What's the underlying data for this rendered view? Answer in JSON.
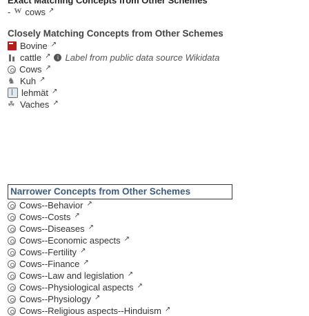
{
  "header": {
    "title": "Exact Matching Concepts from Other Schemes",
    "link_text": "cows"
  },
  "closely_matching": {
    "heading": "Closely Matching Concepts from Other Schemes",
    "items": [
      {
        "label": "Bovine",
        "icon": "flag-icon"
      },
      {
        "label": "cattle",
        "icon": "chart-icon",
        "note": "Label from public data source Wikidata"
      },
      {
        "label": "Cows",
        "icon": "concept-icon"
      },
      {
        "label": "Kuh",
        "icon": "cow-icon"
      },
      {
        "label": "lehmät",
        "icon": "book-icon"
      },
      {
        "label": "Vaches",
        "icon": "leaf-icon"
      }
    ]
  },
  "narrower": {
    "heading": "Narrower Concepts from Other Schemes",
    "items": [
      "Cows--Behavior",
      "Cows--Costs",
      "Cows--Diseases",
      "Cows--Economic aspects",
      "Cows--Fertility",
      "Cows--Finance",
      "Cows--Law and legislation",
      "Cows--Physiological aspects",
      "Cows--Physiology",
      "Cows--Religious aspects--Hinduism"
    ]
  }
}
